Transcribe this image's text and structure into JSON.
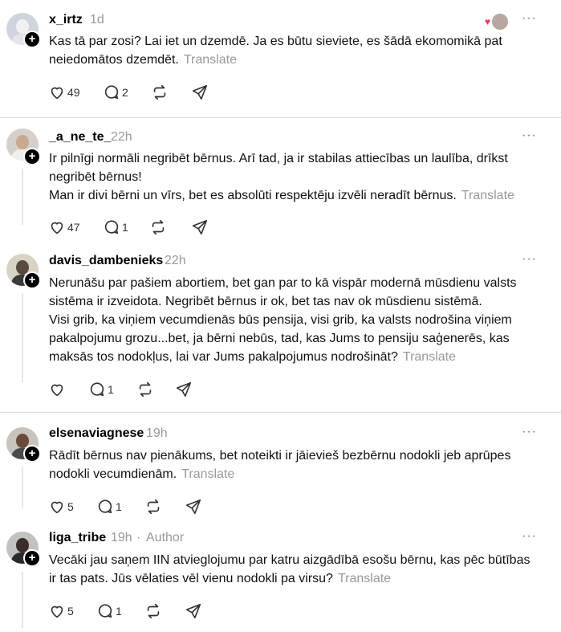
{
  "posts": [
    {
      "username": "x_irtz",
      "time": "1d",
      "text": "Kas tā par zosi? Lai iet un dzemdē. Ja es būtu sieviete, es šādā ekomomikā pat neiedomātos dzemdēt.",
      "translate": "Translate",
      "likes": "49",
      "replies": "2"
    },
    {
      "username": "_a_ne_te_",
      "time": "22h",
      "text_lines": [
        "Ir pilnīgi normāli negribēt bērnus. Arī tad, ja ir stabilas attiecības un laulība, drīkst negribēt bērnus!",
        "Man ir divi bērni un vīrs, bet es absolūti respektēju izvēli neradīt bērnus."
      ],
      "translate": "Translate",
      "likes": "47",
      "replies": "1"
    },
    {
      "username": "davis_dambenieks",
      "time": "22h",
      "text_lines": [
        "Nerunāšu par pašiem abortiem, bet gan par to kā vispār modernā mūsdienu valsts sistēma ir izveidota. Negribēt bērnus ir ok, bet tas nav ok mūsdienu sistēmā.",
        "Visi grib, ka viņiem vecumdienās būs pensija, visi grib, ka valsts nodrošina viņiem pakalpojumu grozu...bet, ja bērni nebūs, tad, kas Jums to pensiju saģenerēs, kas maksās tos nodokļus, lai var Jums pakalpojumus nodrošināt?"
      ],
      "translate": "Translate",
      "likes": "",
      "replies": "1"
    },
    {
      "username": "elsenaviagnese",
      "time": "19h",
      "text": "Rādīt bērnus nav pienākums, bet noteikti ir jāievieš bezbērnu nodokli jeb aprūpes nodokli vecumdienām.",
      "translate": "Translate",
      "likes": "5",
      "replies": "1"
    },
    {
      "username": "liga_tribe",
      "time": "19h",
      "author_label": "Author",
      "separator": "·",
      "text": "Vecāki jau saņem IIN atvieglojumu par katru aizgādībā esošu bērnu, kas pēc būtības ir tas pats. Jūs vēlaties vēl vienu nodokli pa virsu?",
      "translate": "Translate",
      "likes": "5",
      "replies": "1"
    }
  ],
  "more_label": "···",
  "plus_label": "+",
  "heart_glyph": "♥",
  "colors": {
    "meta": "#999999",
    "heart": "#ff2d55",
    "divider": "#dedede"
  }
}
